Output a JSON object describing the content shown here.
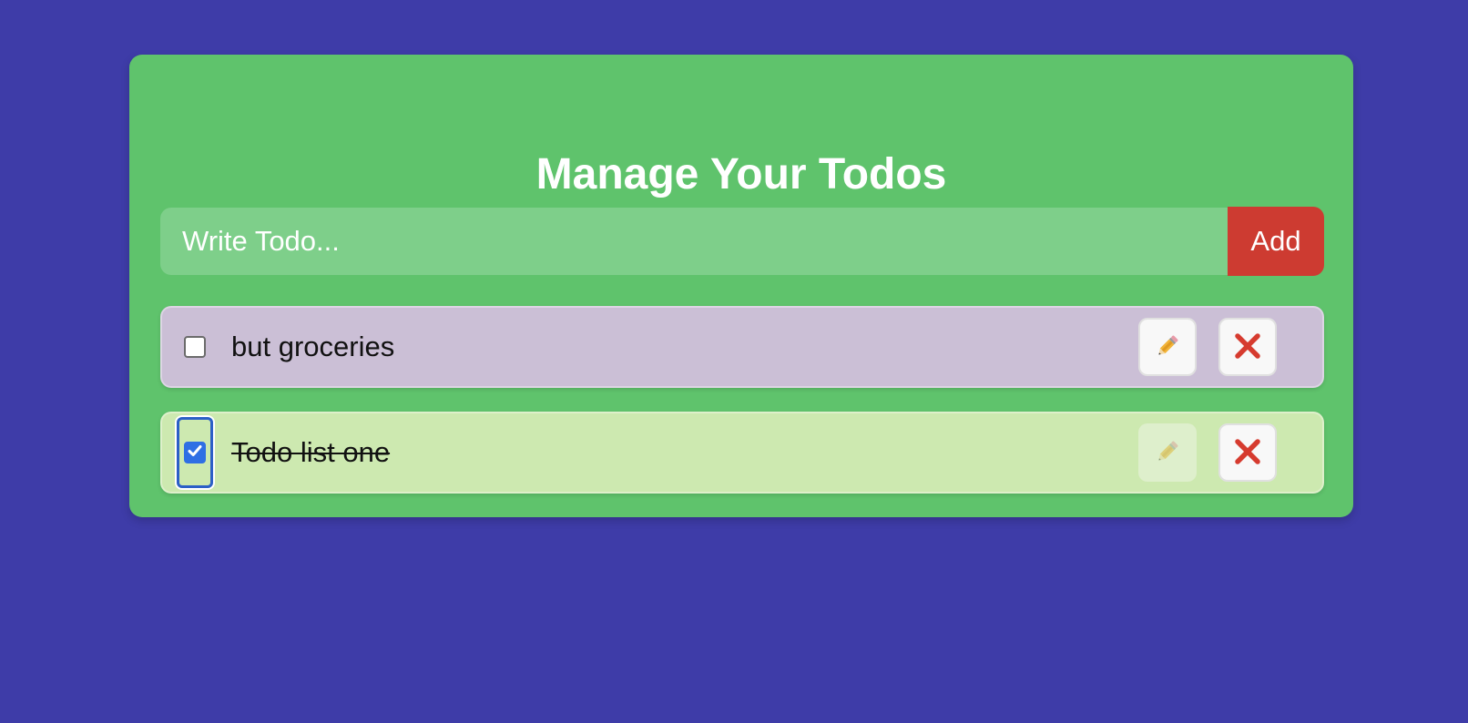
{
  "app": {
    "title": "Manage Your Todos"
  },
  "add_form": {
    "placeholder": "Write Todo...",
    "value": "",
    "add_label": "Add"
  },
  "todos": [
    {
      "text": "but groceries",
      "completed": false,
      "edit_enabled": true
    },
    {
      "text": "Todo list one",
      "completed": true,
      "edit_enabled": false
    }
  ],
  "icons": {
    "edit": "pencil-icon",
    "delete": "close-icon",
    "check": "checkmark-icon"
  },
  "colors": {
    "page_background": "#3e3ca8",
    "card_background": "#5fc36c",
    "input_background": "#7ecf8a",
    "add_button": "#cd3b31",
    "todo_pending_background": "#cbbfd6",
    "todo_done_background": "#cde9b0",
    "delete_icon": "#d63b2f",
    "checkbox_checked": "#2f6fe4"
  }
}
